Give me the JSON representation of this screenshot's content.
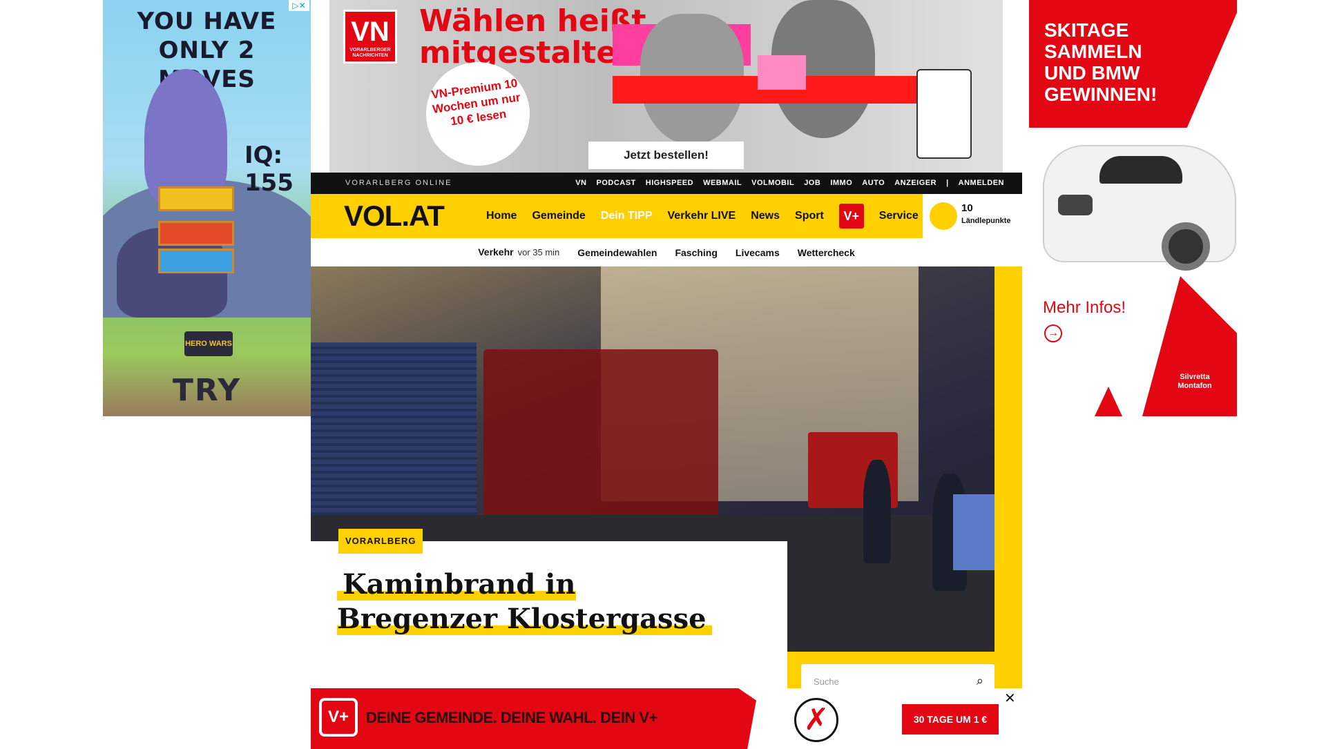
{
  "left_ad": {
    "headline": "YOU HAVE ONLY 2 MOVES",
    "iq": "IQ: 155",
    "brand": "HERO WARS",
    "cta": "TRY",
    "adchoices": "▷✕"
  },
  "top_ad": {
    "logo": "VN",
    "logo_sub": "VORARLBERGER NACHRICHTEN",
    "headline_line1": "Wählen heißt",
    "headline_line2": "mitgestalten",
    "offer": "VN-Premium 10 Wochen um nur 10 € lesen",
    "cta": "Jetzt bestellen!"
  },
  "right_ad": {
    "headline": "SKITAGE SAMMELN UND BMW GEWINNEN!",
    "more": "Mehr Infos!",
    "brand": "Silvretta Montafon"
  },
  "topbar": {
    "brand": "VORARLBERG ONLINE",
    "links": [
      "VN",
      "PODCAST",
      "HIGHSPEED",
      "WEBMAIL",
      "VOLMOBIL",
      "JOB",
      "IMMO",
      "AUTO",
      "ANZEIGER"
    ],
    "separator": "|",
    "login": "ANMELDEN"
  },
  "mainnav": {
    "logo": "VOL.AT",
    "items": [
      "Home",
      "Gemeinde",
      "Dein TIPP",
      "Verkehr LIVE",
      "News",
      "Sport"
    ],
    "vplus": "V+",
    "service": "Service",
    "points_value": "10",
    "points_label": "Ländlepunkte"
  },
  "subnav": {
    "traffic": "Verkehr",
    "traffic_time": "vor 35 min",
    "items": [
      "Gemeindewahlen",
      "Fasching",
      "Livecams",
      "Wettercheck"
    ]
  },
  "article": {
    "category": "VORARLBERG",
    "title": "Kaminbrand in Bregenzer Klostergasse"
  },
  "search": {
    "placeholder": "Suche"
  },
  "bottom_ad": {
    "logo": "V+",
    "slogan": "DEINE GEMEINDE. DEINE WAHL. DEIN V+",
    "cta": "30 TAGE UM 1 €",
    "close": "✕"
  }
}
